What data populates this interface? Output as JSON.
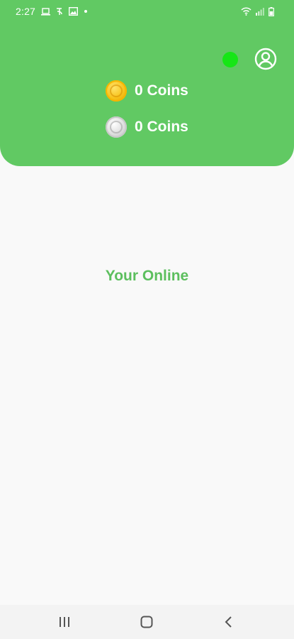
{
  "status_bar": {
    "time": "2:27"
  },
  "header": {
    "online_indicator_color": "#16e616",
    "profile_icon": "profile-icon",
    "coins": {
      "gold": {
        "icon": "gold-coin-icon",
        "text": "0 Coins"
      },
      "silver": {
        "icon": "silver-coin-icon",
        "text": "0 Coins"
      }
    }
  },
  "main": {
    "status_message": "Your Online"
  },
  "colors": {
    "header_bg": "#61c963",
    "accent_text": "#5cbf5e",
    "background": "#f9f9f9"
  },
  "nav_bar": {
    "recents_icon": "recents-icon",
    "home_icon": "home-icon",
    "back_icon": "back-icon"
  }
}
